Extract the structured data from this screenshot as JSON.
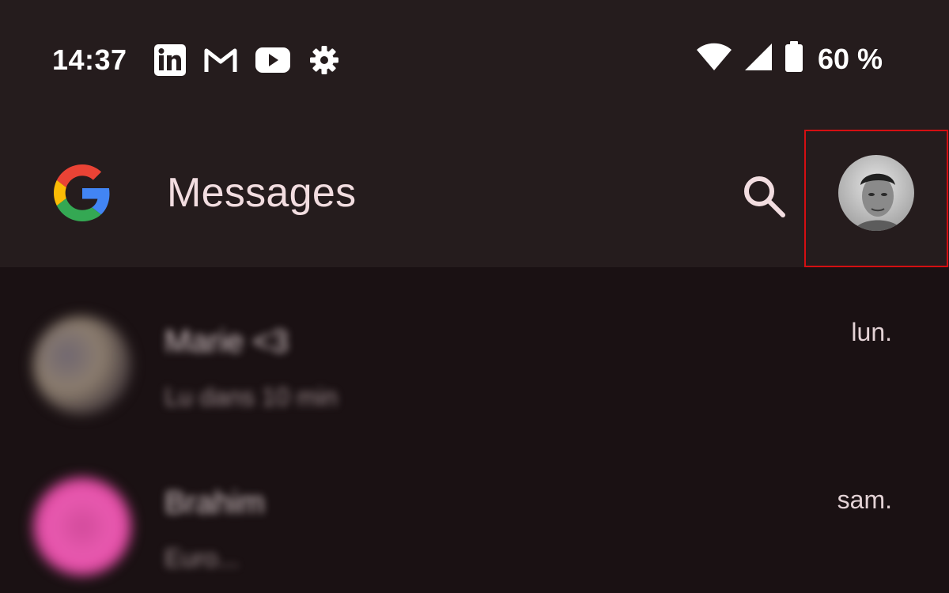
{
  "status_bar": {
    "time": "14:37",
    "notification_icons": [
      "linkedin-icon",
      "gmail-icon",
      "youtube-icon",
      "settings-icon"
    ],
    "system_icons": [
      "wifi-icon",
      "cell-signal-icon",
      "battery-icon"
    ],
    "battery_percent": "60 %"
  },
  "app_bar": {
    "title": "Messages",
    "logo": "google-g-logo",
    "search_icon": "search-icon",
    "account_avatar": "account-avatar"
  },
  "conversations": [
    {
      "name": "Marie <3",
      "snippet": "Lu dans 10 min",
      "time": "lun."
    },
    {
      "name": "Brahim",
      "snippet": "Euro...",
      "time": "sam."
    }
  ],
  "colors": {
    "app_bar_bg": "#251c1d",
    "list_bg": "#1a1113",
    "title_text": "#f2dde0",
    "highlight_border": "#d40f12"
  }
}
